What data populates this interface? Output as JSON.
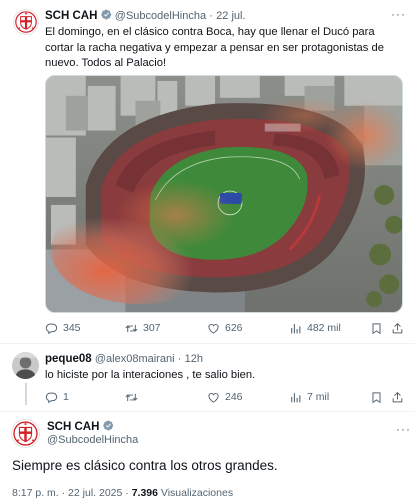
{
  "colors": {
    "text": "#0f1419",
    "muted": "#536471",
    "verified": "#829aab",
    "border": "#cfd9de"
  },
  "tweet1": {
    "name": "SCH CAH",
    "handle": "@SubcodelHincha",
    "separator": "·",
    "date": "22 jul.",
    "body": "El domingo, en el clásico contra Boca, hay que llenar el Ducó para cortar la racha negativa y empezar a pensar en ser protagonistas de nuevo. Todos al Palacio!",
    "more_icon": "ellipsis-icon",
    "media_alt": "aerial-stadium-photo",
    "actions": {
      "replies": "345",
      "retweets": "307",
      "likes": "626",
      "views": "482 mil"
    }
  },
  "reply": {
    "name": "peque08",
    "handle": "@alex08mairani",
    "separator": "·",
    "date": "12h",
    "body": "lo hiciste por la interaciones , te salio bien.",
    "actions": {
      "replies": "1",
      "retweets": "",
      "likes": "246",
      "views": "7 mil"
    }
  },
  "tweet3": {
    "name": "SCH CAH",
    "handle": "@SubcodelHincha",
    "body": "Siempre es clásico contra los otros grandes.",
    "time": "8:17 p. m.",
    "separator": "·",
    "date": "22 jul. 2025",
    "views_count": "7.396",
    "views_label": "Visualizaciones"
  }
}
